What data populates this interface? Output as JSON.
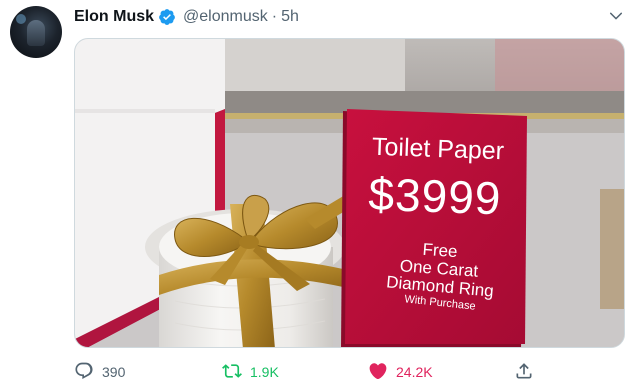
{
  "tweet": {
    "author_name": "Elon Musk",
    "handle": "@elonmusk",
    "separator": "·",
    "time": "5h"
  },
  "image": {
    "sign_title": "Toilet Paper",
    "price": "$3999",
    "line1": "Free",
    "line2": "One Carat",
    "line3": "Diamond Ring",
    "line4": "With Purchase"
  },
  "actions": {
    "replies": "390",
    "retweets": "1.9K",
    "likes": "24.2K"
  },
  "icons": {
    "verified": "verified-badge-icon",
    "more": "chevron-down-icon",
    "reply": "reply-icon",
    "retweet": "retweet-icon",
    "like": "heart-icon",
    "share": "share-icon"
  },
  "colors": {
    "verified_blue": "#1d9bf0",
    "retweet_green": "#17bf63",
    "like_red": "#e0245e",
    "sign_red": "#c8103e"
  }
}
